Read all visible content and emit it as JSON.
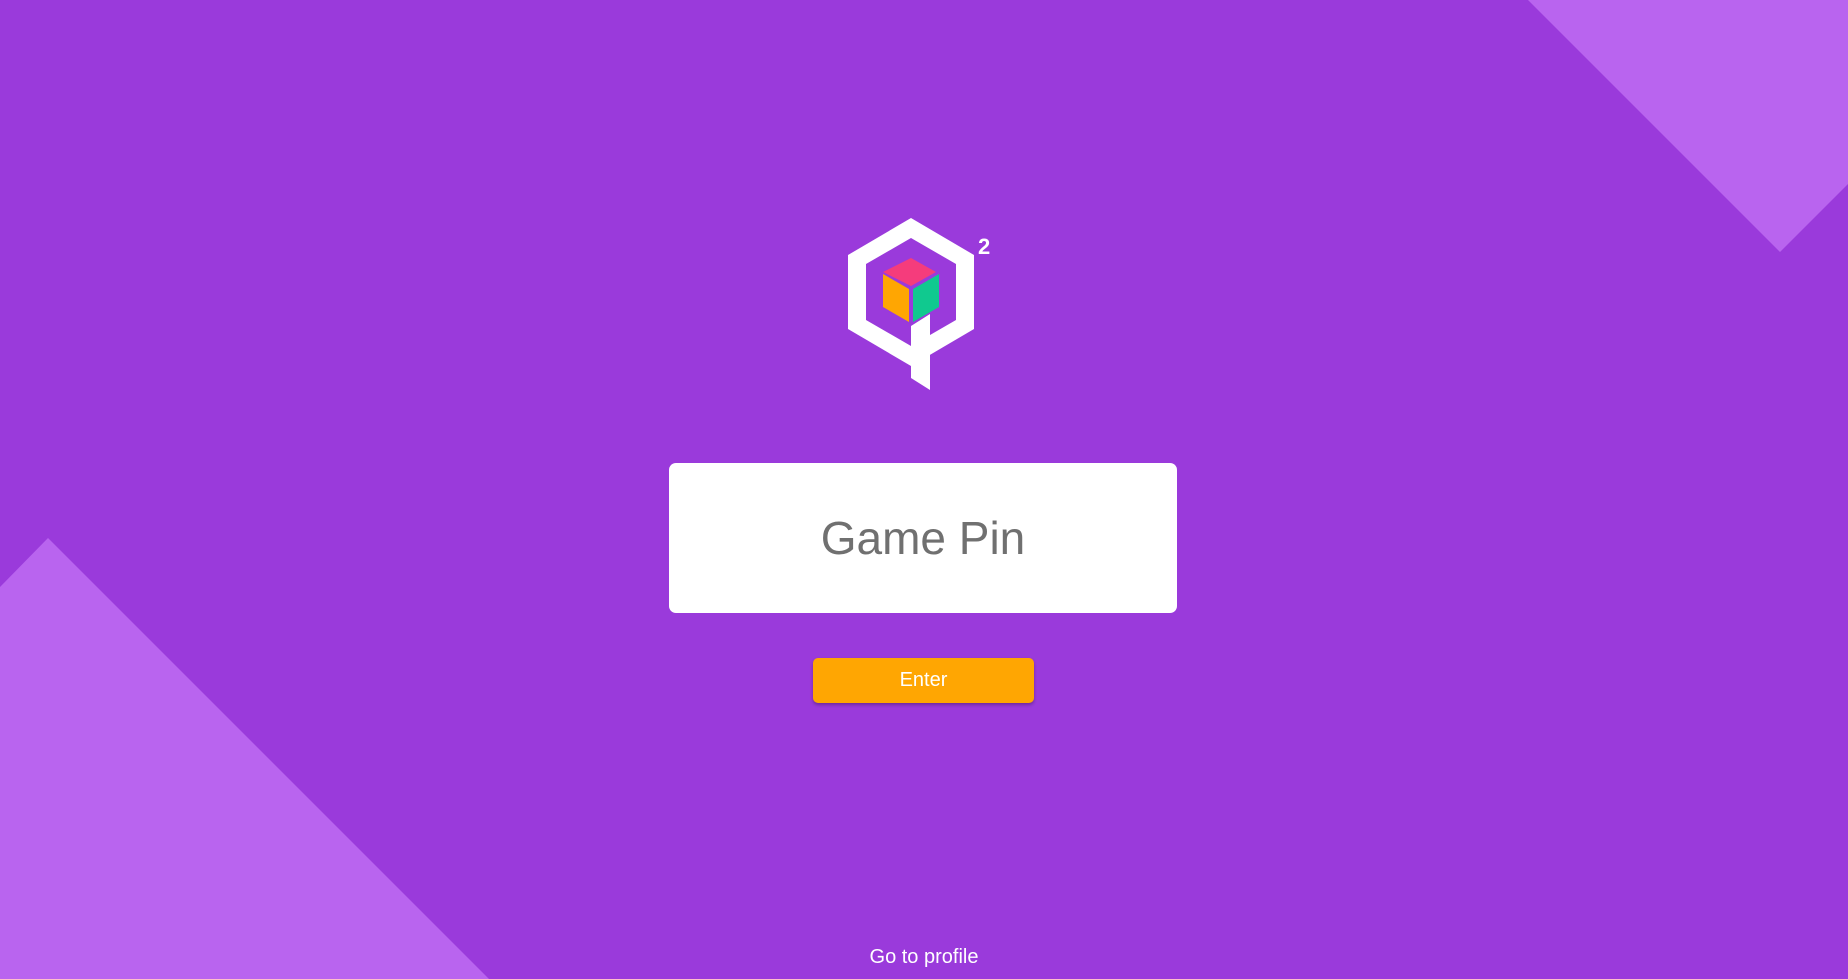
{
  "logo": {
    "superscript": "2",
    "colors": {
      "hexagon": "#ffffff",
      "cube_top": "#f53c7c",
      "cube_left": "#ffa602",
      "cube_right": "#10c98f"
    }
  },
  "pin_input": {
    "placeholder": "Game Pin",
    "value": ""
  },
  "enter_button": {
    "label": "Enter"
  },
  "profile_link": {
    "label": "Go to profile"
  },
  "colors": {
    "background": "#9a3adb",
    "accent_shape": "#b964ef",
    "button": "#ffa602",
    "input_background": "#ffffff"
  }
}
